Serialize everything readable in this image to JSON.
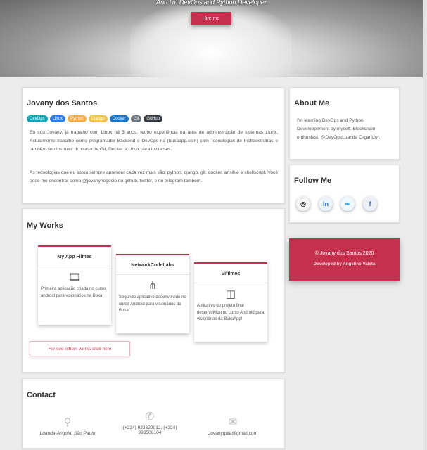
{
  "hero": {
    "tagline": "And I'm DevOps and Python Developer",
    "hire_label": "Hire me",
    "scroll_glyph": "ˇ"
  },
  "about": {
    "name": "Jovany dos Santos",
    "tags": [
      {
        "label": "DevOps",
        "color": "#17a2b8"
      },
      {
        "label": "Linux",
        "color": "#2a7de1"
      },
      {
        "label": "Python",
        "color": "#f0ad4e"
      },
      {
        "label": "Django",
        "color": "#f2c14e"
      },
      {
        "label": "Docker",
        "color": "#1d75c4"
      },
      {
        "label": "Git",
        "color": "#6c757d"
      },
      {
        "label": "GitHub",
        "color": "#343a40"
      }
    ],
    "bio_1": "Eu sou Jovany, já trabalho com Linux há 3 anos, tenho experiência na área de administração de sistemas Liunx, Actualmente trabalho como programador Backend e DevOps na (bukaapp.com) com Tecnologias de Insfraestrutras e também sou instrutor do curso de Git, Docker e Linux para iniciantes.",
    "bio_2": "As tecnologias que eu estou sempre aprender cada vez mais são: python, django, git, docker, ansible e shellscript. Você pode me encontrar como @jovanynegocio no github, twitter, e no telegram também."
  },
  "works": {
    "title": "My Works",
    "items": [
      {
        "title": "My App Filmes",
        "icon": "film-icon",
        "description": "Primeira aplicação criada no curso android para visionários na Buka!"
      },
      {
        "title": "NetworkCodeLabs",
        "icon": "fork-icon",
        "description": "Segundo aplicativo desenvolvido no curso Android para visionários da Buka!"
      },
      {
        "title": "Vifilmes",
        "icon": "add-media-icon",
        "description": "Aplicativo do projeto final desenvolvido no curso Android para visionários da BukaApp!"
      }
    ],
    "see_more_label": "For see others works click here"
  },
  "contact": {
    "title": "Contact",
    "location": "Luanda-Angola, São Paulo",
    "phone": "(+224) 923622012, (+224) 993508104",
    "email": "Jovanyguia@gmail.com"
  },
  "about_me": {
    "title": "About Me",
    "text": "I'm learning DevOps and Python Developpement by myself. Blockchain enthusiast, @DevOpsLuanda Organizer."
  },
  "follow": {
    "title": "Follow Me",
    "networks": [
      {
        "name": "github-icon",
        "glyph": "◎",
        "color": "#333333"
      },
      {
        "name": "linkedin-icon",
        "glyph": "in",
        "color": "#2867b2"
      },
      {
        "name": "twitter-icon",
        "glyph": "❧",
        "color": "#1da1f2"
      },
      {
        "name": "facebook-icon",
        "glyph": "f",
        "color": "#3b5998"
      }
    ]
  },
  "footer": {
    "copyright": "© Jovany dos Santos 2020",
    "developed_by": "Developed by Angelino Valeta"
  },
  "colors": {
    "accent": "#c4304e"
  }
}
